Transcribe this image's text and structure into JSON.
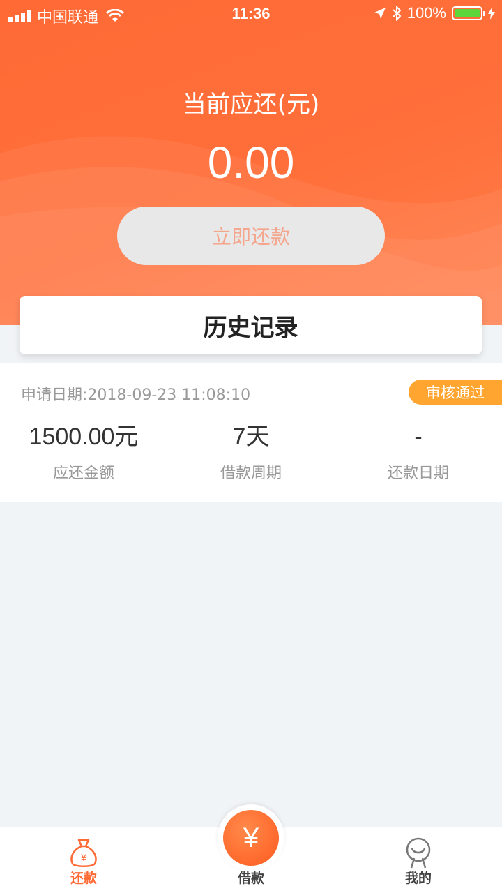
{
  "status_bar": {
    "carrier": "中国联通",
    "time": "11:36",
    "battery": "100%"
  },
  "header": {
    "due_label": "当前应还(元)",
    "due_amount": "0.00",
    "repay_button": "立即还款"
  },
  "history": {
    "title": "历史记录"
  },
  "record": {
    "apply_date": "申请日期:2018-09-23 11:08:10",
    "status": "审核通过",
    "stats": [
      {
        "value": "1500.00元",
        "label": "应还金额"
      },
      {
        "value": "7天",
        "label": "借款周期"
      },
      {
        "value": "-",
        "label": "还款日期"
      }
    ]
  },
  "tabbar": {
    "repay": "还款",
    "borrow": "借款",
    "borrow_symbol": "¥",
    "mine": "我的"
  },
  "colors": {
    "brand": "#ff6a35",
    "badge": "#ffa530",
    "battery": "#5dd63b"
  }
}
